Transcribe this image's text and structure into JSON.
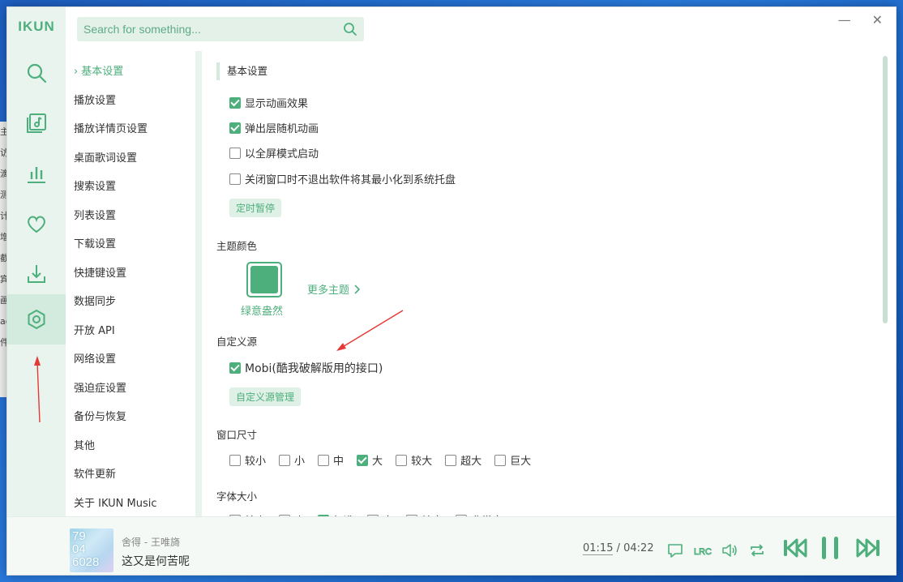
{
  "app": {
    "logo": "IKUN"
  },
  "search": {
    "placeholder": "Search for something..."
  },
  "window_controls": {
    "minimize": "—",
    "close": "✕"
  },
  "nav_icons": [
    "search-icon",
    "music-library-icon",
    "chart-icon",
    "heart-icon",
    "download-icon",
    "settings-icon"
  ],
  "settings_menu": {
    "items": [
      "基本设置",
      "播放设置",
      "播放详情页设置",
      "桌面歌词设置",
      "搜索设置",
      "列表设置",
      "下载设置",
      "快捷键设置",
      "数据同步",
      "开放 API",
      "网络设置",
      "强迫症设置",
      "备份与恢复",
      "其他",
      "软件更新",
      "关于 IKUN Music"
    ],
    "active_marker": "›"
  },
  "basic": {
    "title": "基本设置",
    "options": [
      {
        "label": "显示动画效果",
        "checked": true
      },
      {
        "label": "弹出层随机动画",
        "checked": true
      },
      {
        "label": "以全屏模式启动",
        "checked": false
      },
      {
        "label": "关闭窗口时不退出软件将其最小化到系统托盘",
        "checked": false
      }
    ],
    "timer_button": "定时暂停"
  },
  "theme": {
    "title": "主题颜色",
    "current_name": "绿意盎然",
    "current_color": "#4daf7c",
    "more_label": "更多主题"
  },
  "custom_source": {
    "title": "自定义源",
    "option": {
      "label": "Mobi(酷我破解版用的接口)",
      "checked": true
    },
    "manage_button": "自定义源管理"
  },
  "window_size": {
    "title": "窗口尺寸",
    "options": [
      {
        "label": "较小",
        "checked": false
      },
      {
        "label": "小",
        "checked": false
      },
      {
        "label": "中",
        "checked": false
      },
      {
        "label": "大",
        "checked": true
      },
      {
        "label": "较大",
        "checked": false
      },
      {
        "label": "超大",
        "checked": false
      },
      {
        "label": "巨大",
        "checked": false
      }
    ]
  },
  "font_size": {
    "title": "字体大小",
    "options": [
      {
        "label": "较小",
        "checked": false
      },
      {
        "label": "小",
        "checked": false
      },
      {
        "label": "标准",
        "checked": true
      },
      {
        "label": "大",
        "checked": false
      },
      {
        "label": "较大",
        "checked": false
      },
      {
        "label": "非常大",
        "checked": false
      }
    ]
  },
  "player": {
    "cover_text": "79\n04\n6028",
    "song_title": "舍得 - 王唯旖",
    "lyric": "这又是何苦呢",
    "current_time": "01:15",
    "separator": " / ",
    "total_time": "04:22",
    "icons": [
      "comment-icon",
      "lyric-icon",
      "volume-icon",
      "repeat-icon",
      "previous-icon",
      "pause-icon",
      "next-icon"
    ]
  },
  "colors": {
    "accent": "#4daf7c",
    "sidebar_bg": "#eaf4ef",
    "annotation": "#e53935"
  },
  "desktop_strip": [
    "主",
    "访",
    "滴",
    "测",
    "计",
    "增",
    "截",
    "宾",
    "画",
    "ad",
    "件"
  ]
}
